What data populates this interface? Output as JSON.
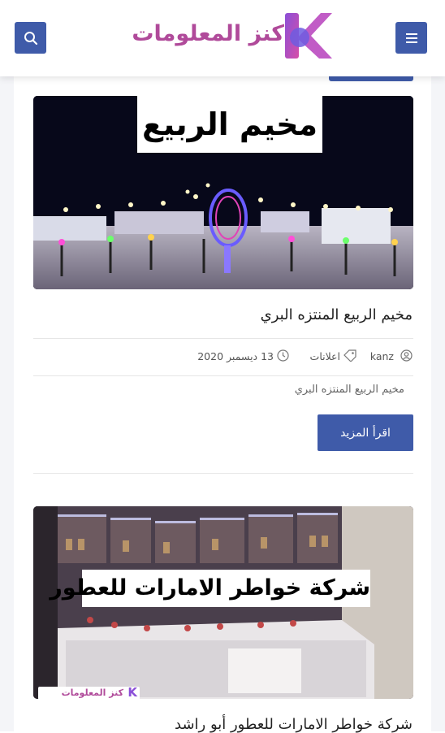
{
  "site": {
    "logo_text": "كنز المعلومات",
    "logo_letter": "K"
  },
  "header": {
    "search_icon": "search-icon",
    "menu_icon": "menu-icon"
  },
  "posts": [
    {
      "image_caption": "مخيم الربيع",
      "title": "مخيم الربيع المنتزه البري",
      "author": "kanz",
      "category": "اعلانات",
      "date": "13 ديسمبر 2020",
      "excerpt": "مخيم الربيع المنتزه البري",
      "read_more": "اقرأ المزيد"
    },
    {
      "image_caption": "شركة خواطر الامارات للعطور",
      "image_watermark": "كنز المعلومات",
      "title": "شركة خواطر الامارات للعطور أبو راشد"
    }
  ],
  "colors": {
    "accent": "#3f5ba9",
    "logo_pink": "#b04a9a",
    "logo_purple": "#8b4fd8"
  }
}
